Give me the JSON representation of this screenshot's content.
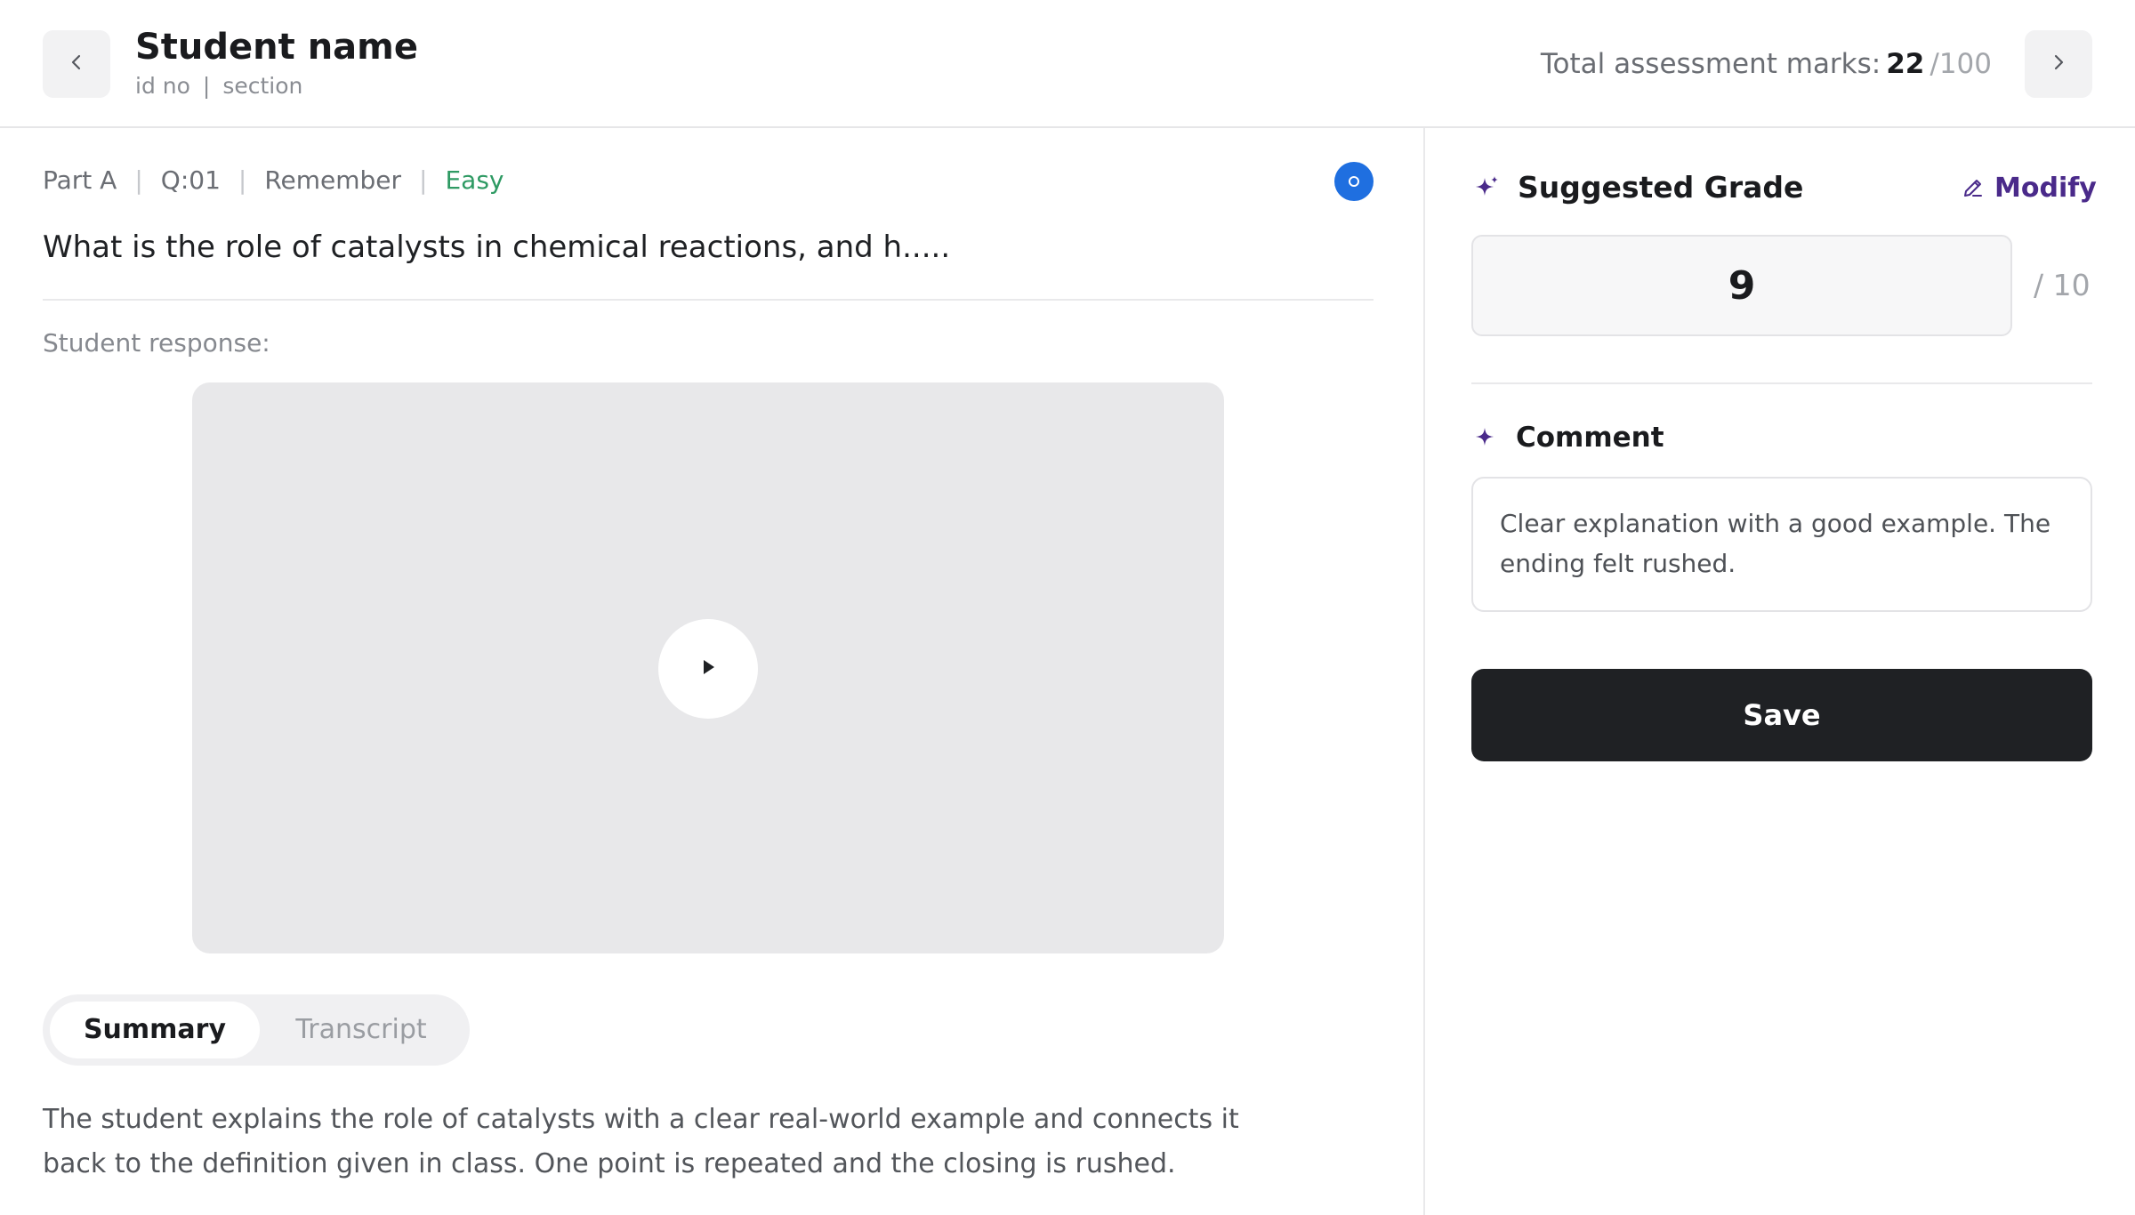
{
  "header": {
    "student_name": "Student name",
    "id_label": "id no",
    "meta_separator": "|",
    "section_label": "section",
    "total_marks_label": "Total assessment marks:",
    "total_marks_value": "22",
    "total_marks_max": "/100",
    "prev_icon": "chevron-left-icon",
    "next_icon": "chevron-right-icon"
  },
  "question": {
    "part": "Part A",
    "number": "Q:01",
    "bloom_level": "Remember",
    "difficulty": "Easy",
    "difficulty_color": "#2e9a63",
    "separator": "|",
    "text": "What is the role of catalysts in chemical reactions, and h.....",
    "status_color": "#1f6fe0"
  },
  "response": {
    "label": "Student response:",
    "play_icon": "play-icon",
    "tabs": [
      {
        "label": "Summary",
        "active": true
      },
      {
        "label": "Transcript",
        "active": false
      }
    ],
    "summary_text": "The student explains the role of catalysts with a clear real-world example and connects it back to the definition given in class. One point is repeated and the closing is rushed."
  },
  "grading": {
    "suggested_grade_title": "Suggested Grade",
    "modify_label": "Modify",
    "grade_value": "9",
    "grade_max": "/ 10",
    "comment_title": "Comment",
    "comment_text": "Clear explanation with a good example. The ending felt rushed.",
    "save_label": "Save",
    "accent_color": "#4a2a8a"
  }
}
